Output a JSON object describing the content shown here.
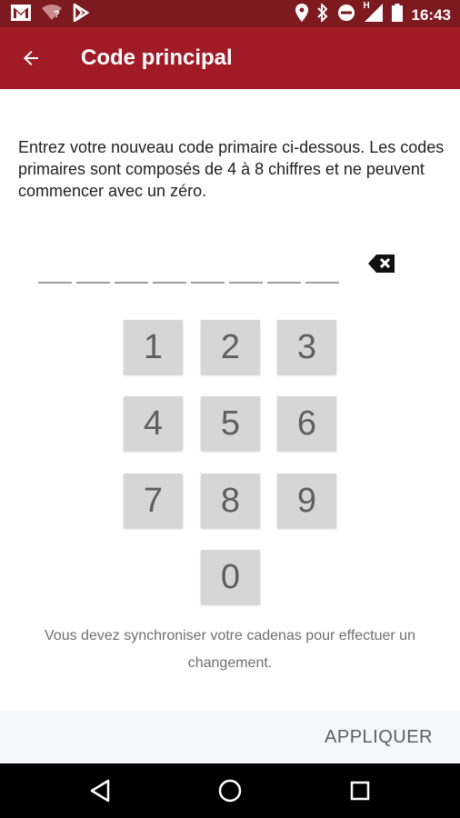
{
  "status_bar": {
    "time": "16:43",
    "network_badge": "?",
    "signal_badge": "H",
    "icons_left": [
      "gmail-icon",
      "wifi-icon",
      "play-store-icon"
    ],
    "icons_right": [
      "location-icon",
      "bluetooth-icon",
      "do-not-disturb-icon",
      "cell-signal-icon",
      "battery-icon"
    ]
  },
  "app_bar": {
    "title": "Code principal",
    "back_icon": "arrow-back-icon",
    "color": "#a11b26"
  },
  "instructions": "Entrez votre nouveau code primaire ci-dessous. Les codes primaires sont composés de 4 à 8 chiffres et ne peuvent commencer avec un zéro.",
  "pin": {
    "slots": 8,
    "backspace_icon": "backspace-icon"
  },
  "keypad": {
    "keys": [
      "1",
      "2",
      "3",
      "4",
      "5",
      "6",
      "7",
      "8",
      "9",
      "0"
    ]
  },
  "sync_note": "Vous devez synchroniser votre cadenas pour effectuer un changement.",
  "actions": {
    "apply_label": "APPLIQUER"
  },
  "nav": {
    "back_icon": "nav-back-icon",
    "home_icon": "nav-home-icon",
    "recents_icon": "nav-recents-icon"
  }
}
